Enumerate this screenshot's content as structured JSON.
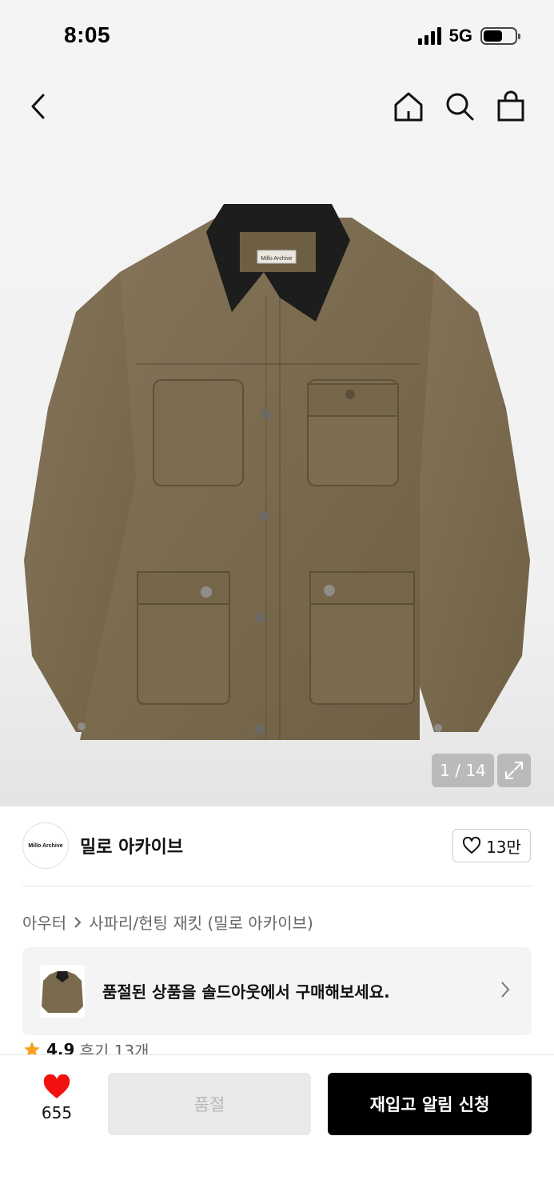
{
  "status_bar": {
    "time": "8:05",
    "network": "5G",
    "battery_level": 0.6
  },
  "nav": {
    "back_icon": "chevron-left-icon",
    "home_icon": "home-icon",
    "search_icon": "search-icon",
    "bag_icon": "shopping-bag-icon"
  },
  "product_image": {
    "counter": "1 / 14",
    "label_tag": "Millo Archive"
  },
  "brand": {
    "logo_text": "Millo Archive",
    "name": "밀로 아카이브",
    "likes": "13만"
  },
  "breadcrumb": {
    "category": "아우터",
    "subcategory": "사파리/헌팅 재킷 (밀로 아카이브)"
  },
  "soldout_banner": {
    "text": "품절된 상품을 솔드아웃에서 구매해보세요."
  },
  "rating": {
    "value": "4.9",
    "reviews": "후기 13개"
  },
  "bottom_bar": {
    "wish_count": "655",
    "soldout_label": "품절",
    "restock_label": "재입고 알림 신청"
  },
  "colors": {
    "accent_red": "#f31110",
    "jacket_khaki": "#7d6c4f",
    "collar_black": "#1d1d1d",
    "star_orange": "#f6a21a"
  }
}
